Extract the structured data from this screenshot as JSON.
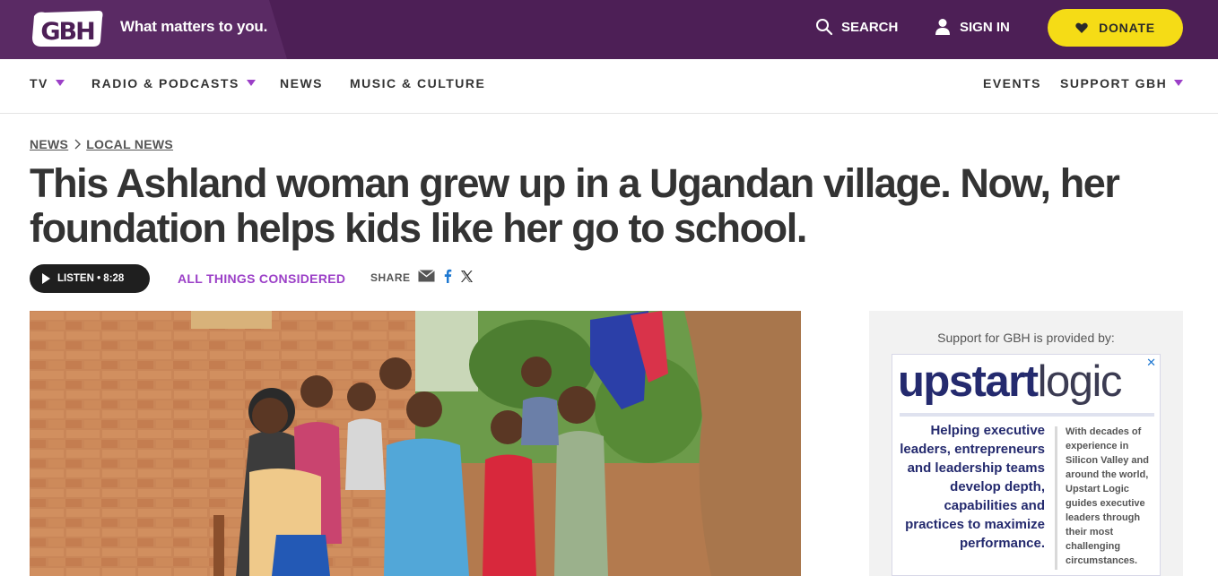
{
  "header": {
    "logo": "GBH",
    "tagline": "What matters to you.",
    "search_label": "SEARCH",
    "signin_label": "SIGN IN",
    "donate_label": "DONATE"
  },
  "nav": {
    "items": [
      {
        "label": "TV",
        "has_dropdown": true
      },
      {
        "label": "RADIO & PODCASTS",
        "has_dropdown": true
      },
      {
        "label": "NEWS",
        "has_dropdown": false
      },
      {
        "label": "MUSIC & CULTURE",
        "has_dropdown": false
      },
      {
        "label": "EVENTS",
        "has_dropdown": false
      },
      {
        "label": "SUPPORT GBH",
        "has_dropdown": true
      }
    ]
  },
  "breadcrumb": {
    "section": "NEWS",
    "subsection": "LOCAL NEWS"
  },
  "article": {
    "title": "This Ashland woman grew up in a Ugandan village. Now, her foundation helps kids like her go to school.",
    "listen_label": "LISTEN • 8:28",
    "program": "ALL THINGS CONSIDERED",
    "share_label": "SHARE",
    "share_icons": [
      "email-icon",
      "facebook-icon",
      "x-icon"
    ]
  },
  "ad": {
    "label": "Support for GBH is provided by:",
    "close": "✕",
    "brand_bold": "upstart",
    "brand_light": "logic",
    "headline": "Helping executive leaders, entrepreneurs and leadership teams develop depth, capabilities and practices to maximize performance.",
    "body": "With decades of experience in Silicon Valley and around the world, Upstart Logic guides executive leaders through their most challenging circumstances."
  },
  "colors": {
    "header_bg": "#4d1f56",
    "accent_purple": "#9b3fc7",
    "donate_yellow": "#f5dc16",
    "ad_navy": "#242a6e"
  }
}
